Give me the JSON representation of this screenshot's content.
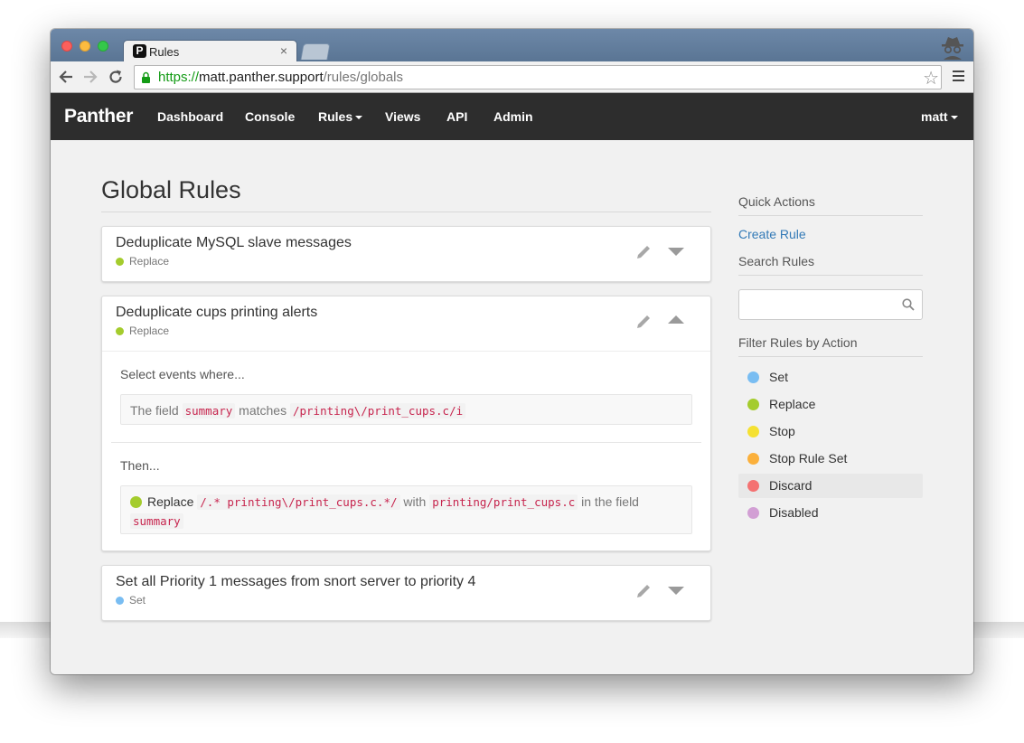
{
  "browser": {
    "tab_title": "Rules",
    "tab_favicon": "P",
    "tab_close": "×",
    "url_scheme": "https://",
    "url_host": "matt.panther.support",
    "url_path": "/rules/globals",
    "icons": [
      "back-icon",
      "forward-icon",
      "reload-icon",
      "lock-icon",
      "star-icon",
      "menu-icon",
      "incognito-icon"
    ]
  },
  "navbar": {
    "brand": "Panther",
    "links": [
      "Dashboard",
      "Console",
      "Rules",
      "Views",
      "API",
      "Admin"
    ],
    "user": "matt"
  },
  "page": {
    "title": "Global Rules"
  },
  "rules": [
    {
      "title": "Deduplicate MySQL slave messages",
      "action": "Replace",
      "action_color": "#a4cc2d",
      "expanded": false
    },
    {
      "title": "Deduplicate cups printing alerts",
      "action": "Replace",
      "action_color": "#a4cc2d",
      "expanded": true,
      "select_label": "Select events where...",
      "condition": {
        "prefix": "The field",
        "field": "summary",
        "operator": "matches",
        "value": "/printing\\/print_cups.c/i"
      },
      "then_label": "Then...",
      "then": {
        "action": "Replace",
        "pattern": "/.* printing\\/print_cups.c.*/",
        "with_word": "with",
        "replacement": " printing/print_cups.c",
        "in_the": "in the",
        "field_word": "field",
        "field": "summary"
      }
    },
    {
      "title": "Set all Priority 1 messages from snort server to priority 4",
      "action": "Set",
      "action_color": "#79bdf2",
      "expanded": false
    }
  ],
  "sidebar": {
    "quick_actions": "Quick Actions",
    "create_rule": "Create Rule",
    "search_rules": "Search Rules",
    "search_placeholder": "",
    "filter_heading": "Filter Rules by Action",
    "filters": [
      {
        "label": "Set",
        "color": "#79bdf2"
      },
      {
        "label": "Replace",
        "color": "#a4cc2d"
      },
      {
        "label": "Stop",
        "color": "#f5e132"
      },
      {
        "label": "Stop Rule Set",
        "color": "#fbb03b"
      },
      {
        "label": "Discard",
        "color": "#f47272"
      },
      {
        "label": "Disabled",
        "color": "#d29fd4"
      }
    ]
  }
}
